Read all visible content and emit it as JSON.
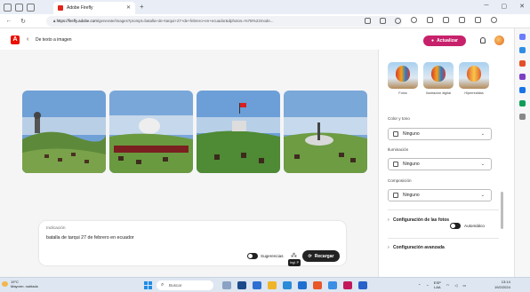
{
  "browser": {
    "tab_title": "Adobe Firefly",
    "url_host": "https://firefly.adobe.com",
    "url_path": "/generate/images?prompt=batalla+de+tarqui+27+de+febrero+en+ecuador&dphotos=%7B%22mode..."
  },
  "app": {
    "logo_letter": "A",
    "breadcrumb": "De texto a imagen",
    "upgrade_label": "Actualizar"
  },
  "prompt": {
    "label": "Indicación",
    "text": "batalla de tarqui 27 de febrero en ecuador",
    "suggestions_label": "Sugerencias",
    "reload_label": "Recargar",
    "tooltip": "Ingl. P"
  },
  "panel": {
    "styles": [
      {
        "caption": "Fotos"
      },
      {
        "caption": "Ilustración digital"
      },
      {
        "caption": "Hiperrealista"
      }
    ],
    "color_label": "Color y tono",
    "color_value": "Ninguno",
    "lighting_label": "Iluminación",
    "lighting_value": "Ninguno",
    "composition_label": "Composición",
    "composition_value": "Ninguno",
    "photo_settings_label": "Configuración de las fotos",
    "photo_settings_mode": "Automático",
    "advanced_label": "Configuración avanzada"
  },
  "taskbar": {
    "weather_temp": "19°C",
    "weather_desc": "Mayorm. nublado",
    "search_placeholder": "Buscar",
    "lang": "ESP",
    "lang_sub": "LAA",
    "time": "13:14",
    "date": "19/2/2024"
  },
  "colors": {
    "adobe_red": "#eb1000",
    "upgrade_pink": "#c7216b",
    "dark_button": "#222222"
  }
}
